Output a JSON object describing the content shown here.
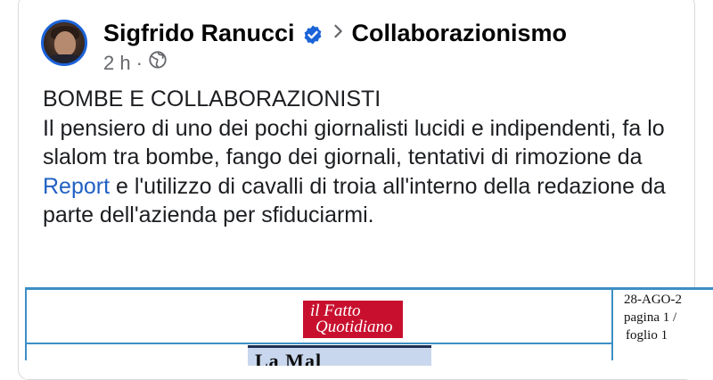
{
  "post": {
    "author": "Sigfrido Ranucci",
    "verified_icon": "verified-badge-icon",
    "separator_icon": "chevron-right-icon",
    "group": "Collaborazionismo",
    "time": "2 h",
    "meta_separator": "·",
    "audience_icon": "globe-icon",
    "text_title": "BOMBE E COLLABORAZIONISTI",
    "text_before_link": "Il pensiero di uno dei pochi giornalisti lucidi e indipendenti, fa lo slalom tra bombe, fango dei giornali, tentativi di rimozione da ",
    "link_text": "Report",
    "text_after_link": " e l'utilizzo di cavalli di troia all'interno della redazione da parte dell'azienda per sfiduciarmi."
  },
  "document": {
    "logo_line1": "il Fatto",
    "logo_line2": "Quotidiano",
    "date": "28-AGO-2",
    "page": "pagina 1 /",
    "sheet": "foglio 1",
    "headline_partial": "La Mal"
  },
  "colors": {
    "link": "#2161c4",
    "verified": "#1b63d8",
    "doc_border": "#3d8fc4",
    "logo_bg": "#c8102e"
  }
}
